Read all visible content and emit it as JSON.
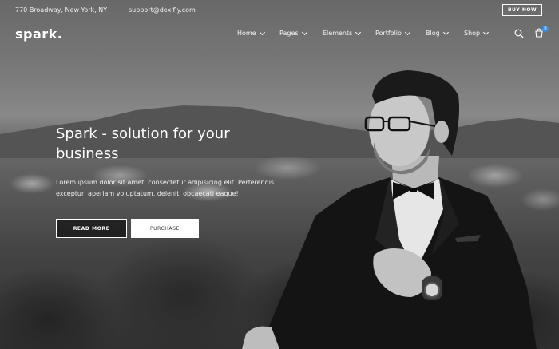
{
  "topbar": {
    "address": "770 Broadway, New York, NY",
    "email": "support@dexifly.com",
    "buy_now": "BUY NOW"
  },
  "logo": "spark.",
  "nav": {
    "items": [
      {
        "label": "Home"
      },
      {
        "label": "Pages"
      },
      {
        "label": "Elements"
      },
      {
        "label": "Portfolio"
      },
      {
        "label": "Blog"
      },
      {
        "label": "Shop"
      }
    ],
    "cart_count": "0"
  },
  "hero": {
    "title": "Spark - solution for your business",
    "text": "Lorem ipsum dolor sit amet, consectetur adipisicing elit. Perferendis excepturi aperiam voluptatum, deleniti obcaecati eaque!",
    "read_more": "READ MORE",
    "purchase": "PURCHASE"
  },
  "colors": {
    "badge": "#3a8fe8",
    "white": "#ffffff"
  }
}
